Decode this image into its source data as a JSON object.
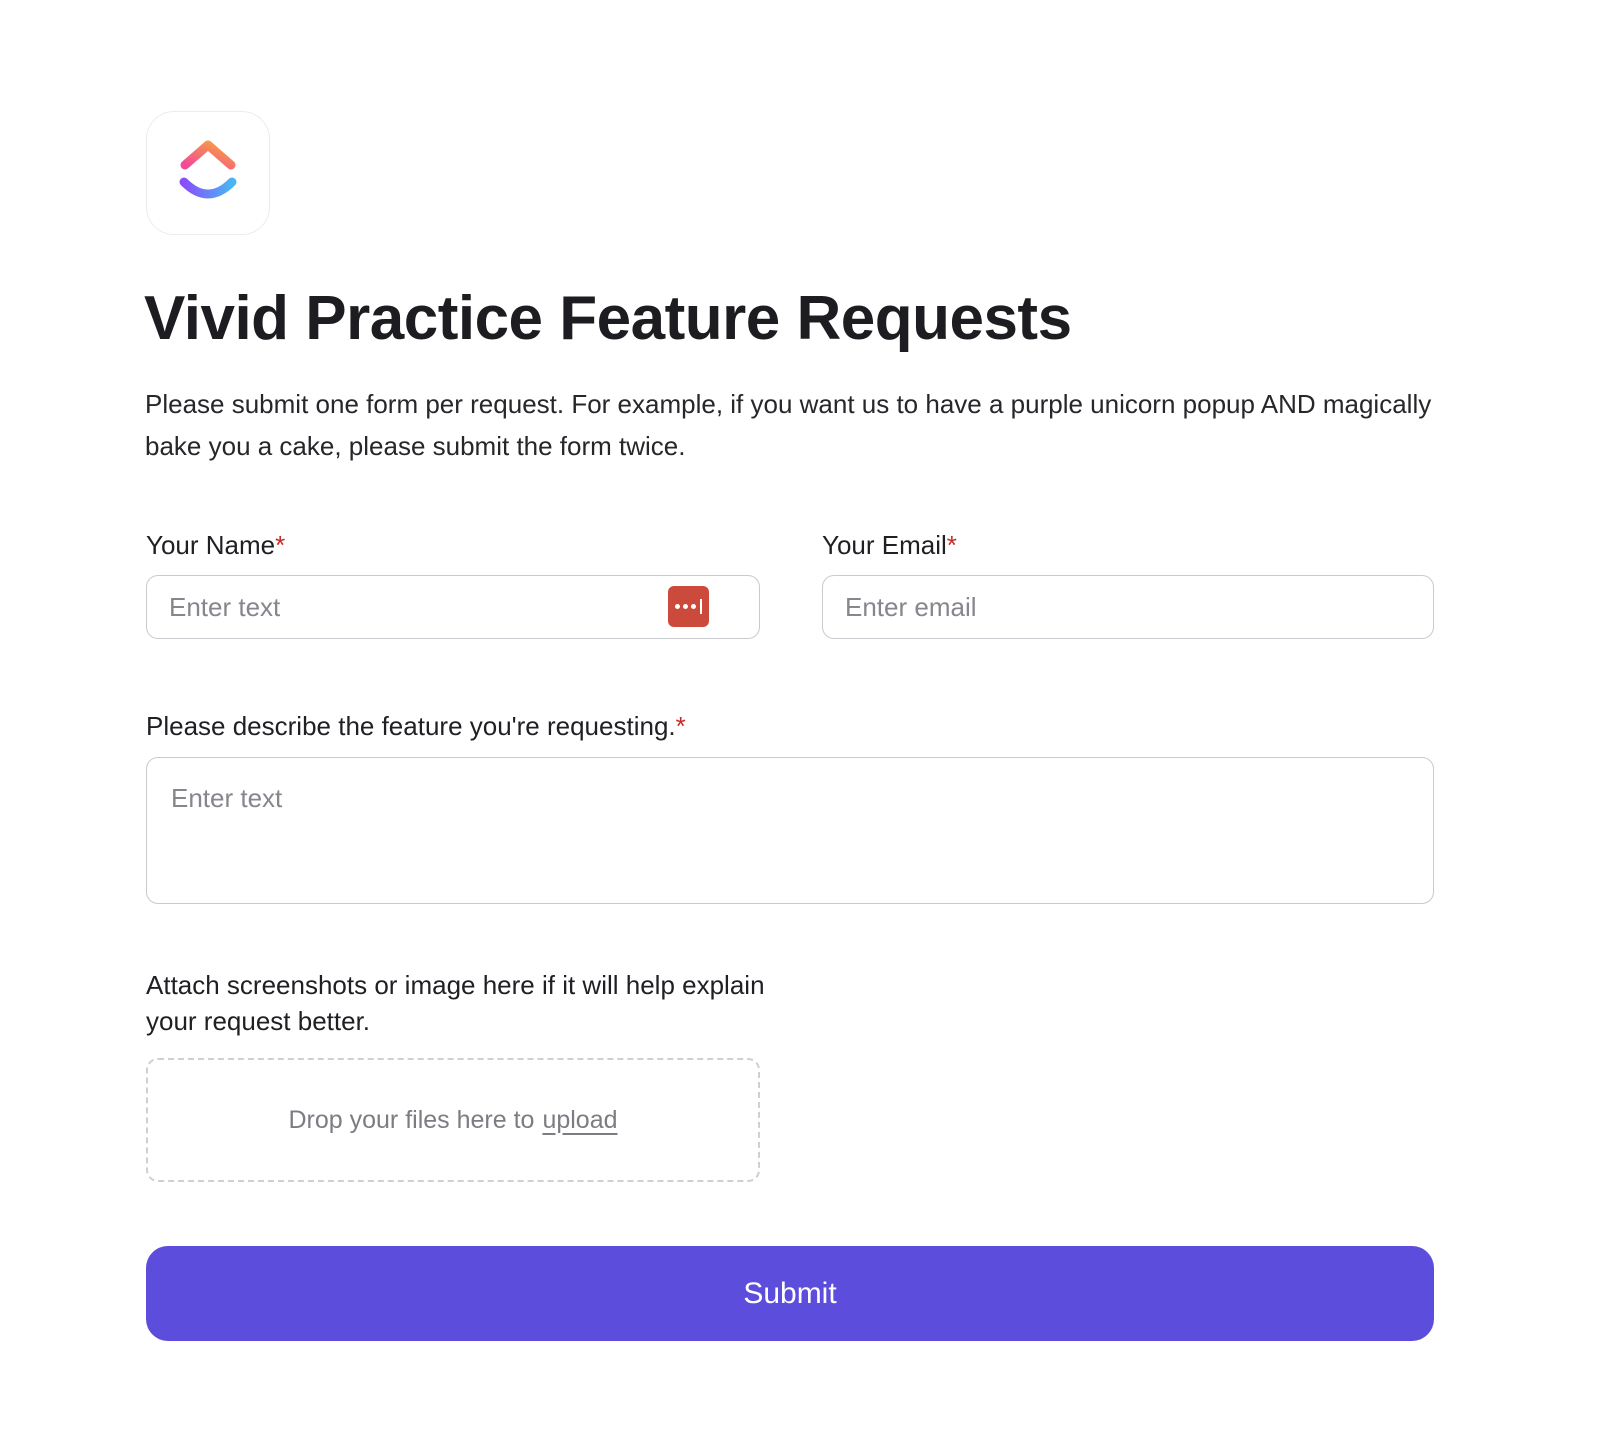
{
  "brand": {
    "logo": "clickup-logo-icon",
    "colors": {
      "logo_top_start": "#f24a9a",
      "logo_top_end": "#f9a23c",
      "logo_bottom_start": "#8a4dfb",
      "logo_bottom_end": "#49b6f6"
    }
  },
  "form": {
    "title": "Vivid Practice Feature Requests",
    "description": "Please submit one form per request. For example, if you want us to have a purple unicorn popup AND magically bake you a cake, please submit the form twice.",
    "required_marker": "*",
    "name_field": {
      "label": "Your Name",
      "placeholder": "Enter text",
      "value": "",
      "autofill_icon": "password-manager-icon"
    },
    "email_field": {
      "label": "Your Email",
      "placeholder": "Enter email",
      "value": ""
    },
    "feature_field": {
      "label": "Please describe the feature you're requesting.",
      "placeholder": "Enter text",
      "value": ""
    },
    "attachment": {
      "label": "Attach screenshots or image here if it will help explain your request better.",
      "drop_text": "Drop your files here to",
      "upload_link": "upload"
    },
    "submit_label": "Submit",
    "colors": {
      "submit_bg": "#5c4ddc",
      "required_marker": "#c62828",
      "autofill_icon_bg": "#cc4a3c"
    }
  }
}
